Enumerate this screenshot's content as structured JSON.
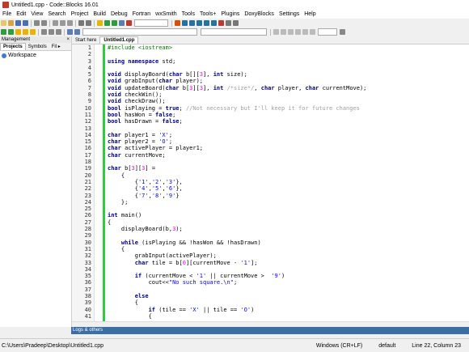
{
  "window": {
    "title": "Untitled1.cpp - Code::Blocks 16.01"
  },
  "menu": [
    "File",
    "Edit",
    "View",
    "Search",
    "Project",
    "Build",
    "Debug",
    "Fortran",
    "wxSmith",
    "Tools",
    "Tools+",
    "Plugins",
    "DoxyBlocks",
    "Settings",
    "Help"
  ],
  "management": {
    "header": "Management",
    "close": "×",
    "tabs": [
      "Projects",
      "Symbols",
      "Fil ▸"
    ],
    "workspace": "Workspace"
  },
  "editor": {
    "tabs": [
      "Start here",
      "Untitled1.cpp"
    ],
    "line_numbers": [
      "1",
      "2",
      "3",
      "4",
      "5",
      "6",
      "7",
      "8",
      "9",
      "10",
      "11",
      "12",
      "13",
      "14",
      "15",
      "16",
      "17",
      "18",
      "19",
      "20",
      "21",
      "22",
      "23",
      "24",
      "25",
      "26",
      "27",
      "28",
      "29",
      "30",
      "31",
      "32",
      "33",
      "34",
      "35",
      "36",
      "37",
      "38",
      "39",
      "40",
      "41"
    ]
  },
  "log_panel": {
    "label": "Logs & others"
  },
  "status": {
    "path": "C:\\Users\\Pradeep\\Desktop\\Untitled1.cpp",
    "eol": "Windows (CR+LF)",
    "encoding": "default",
    "position": "Line 22, Column 23"
  },
  "code_lines": [
    "#include <iostream>",
    "",
    "using namespace std;",
    "",
    "void displayBoard(char b[][3], int size);",
    "void grabInput(char player);",
    "void updateBoard(char b[3][3], int /*size*/, char player, char currentMove);",
    "void checkWin();",
    "void checkDraw();",
    "bool isPlaying = true; //Not necessary but I'll keep it for future changes",
    "bool hasWon = false;",
    "bool hasDrawn = false;",
    "",
    "char player1 = 'X';",
    "char player2 = 'O';",
    "char activePlayer = player1;",
    "char currentMove;",
    "",
    "char b[3][3] = ",
    "    {",
    "        {'1','2','3'},",
    "        {'4','5','6'},",
    "        {'7','8','9'}",
    "    };",
    "",
    "int main()",
    "{",
    "    displayBoard(b,3);",
    "",
    "    while (isPlaying && !hasWon && !hasDrawn)",
    "    {",
    "        grabInput(activePlayer);",
    "        char tile = b[0][currentMove - '1'];",
    "",
    "        if (currentMove < '1' || currentMove >  '9')",
    "            cout<<\"No such square.\\n\";",
    "",
    "        else",
    "        {",
    "            if (tile == 'X' || tile == 'O')",
    "            {"
  ]
}
